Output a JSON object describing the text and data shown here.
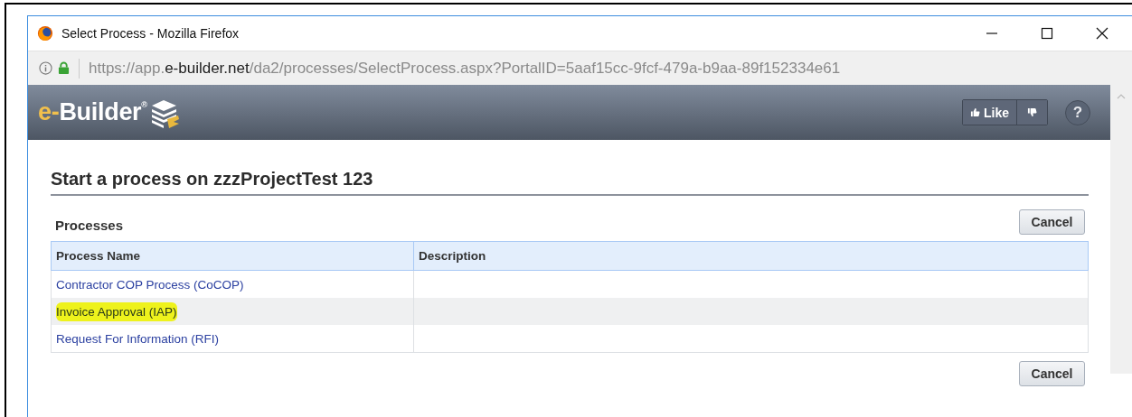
{
  "window": {
    "title": "Select Process - Mozilla Firefox"
  },
  "address_bar": {
    "url_start": "https://app.",
    "url_domain": "e-builder.net",
    "url_rest": "/da2/processes/SelectProcess.aspx?PortalID=5aaf15cc-9fcf-479a-b9aa-89f152334e61",
    "secure": true
  },
  "header": {
    "logo": {
      "prefix": "e-",
      "name": "Builder",
      "mark": "®"
    },
    "like_button": "Like",
    "help_button": "?"
  },
  "page": {
    "heading": "Start a process on zzzProjectTest 123",
    "section_title": "Processes",
    "top_button": "Cancel",
    "bottom_button": "Cancel"
  },
  "table": {
    "columns": [
      "Process Name",
      "Description"
    ],
    "rows": [
      {
        "name": "Contractor COP Process (CoCOP)",
        "selected": false,
        "highlighted": false
      },
      {
        "name": "Invoice Approval (IAP)",
        "selected": true,
        "highlighted": true
      },
      {
        "name": "Request For Information (RFI)",
        "selected": false,
        "highlighted": false
      }
    ]
  }
}
